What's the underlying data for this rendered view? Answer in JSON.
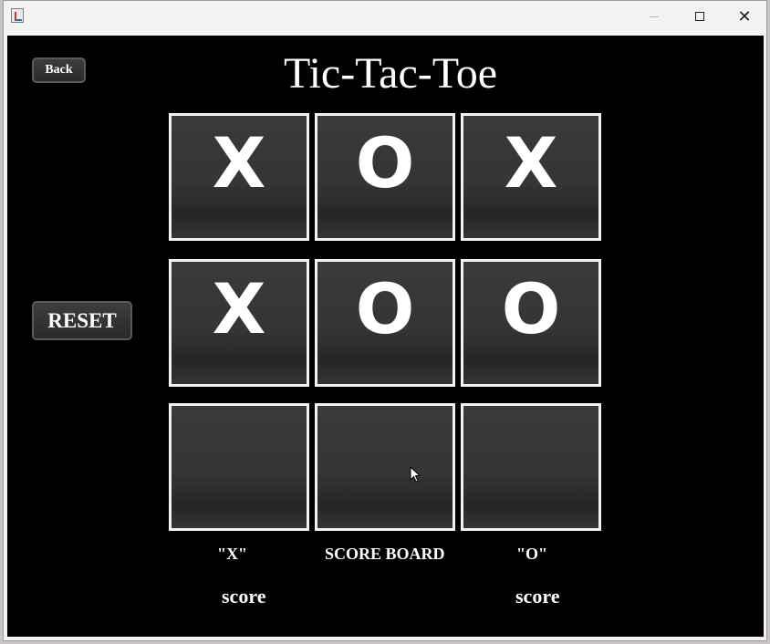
{
  "window": {
    "title": "",
    "controls": {
      "minimize": "",
      "maximize": "",
      "close": "✕"
    }
  },
  "game": {
    "title": "Tic-Tac-Toe",
    "back_label": "Back",
    "reset_label": "RESET",
    "board": [
      [
        "X",
        "O",
        "X"
      ],
      [
        "X",
        "O",
        "O"
      ],
      [
        "",
        "",
        ""
      ]
    ]
  },
  "scoreboard": {
    "heading": "SCORE BOARD",
    "x_label": "\"X\"",
    "o_label": "\"O\"",
    "x_score": "score",
    "o_score": "score"
  }
}
